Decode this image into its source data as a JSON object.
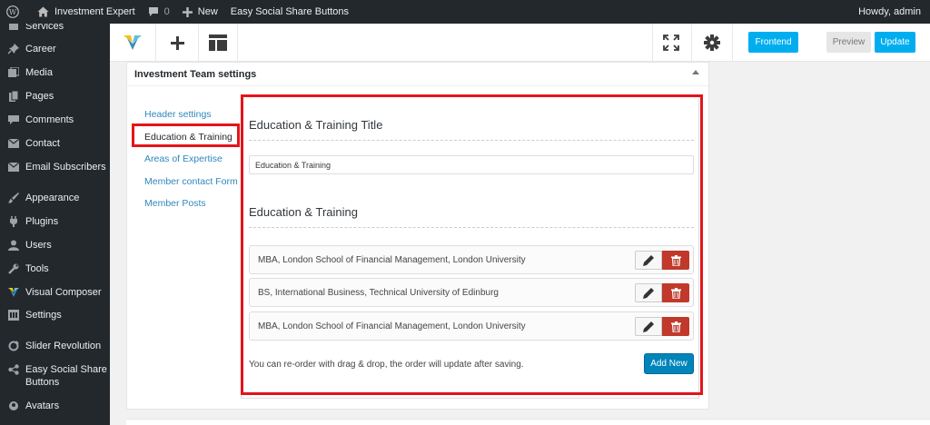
{
  "admin_bar": {
    "site_name": "Investment Expert",
    "comments_count": "0",
    "new_label": "New",
    "plugin_label": "Easy Social Share Buttons",
    "greeting": "Howdy, admin"
  },
  "sidebar": {
    "items": [
      {
        "label": "Services",
        "icon": "services-icon"
      },
      {
        "label": "Career",
        "icon": "pin-icon"
      },
      {
        "label": "Media",
        "icon": "media-icon"
      },
      {
        "label": "Pages",
        "icon": "pages-icon"
      },
      {
        "label": "Comments",
        "icon": "comments-icon"
      },
      {
        "label": "Contact",
        "icon": "envelope-icon"
      },
      {
        "label": "Email Subscribers",
        "icon": "email-icon"
      },
      {
        "label": "Appearance",
        "icon": "brush-icon"
      },
      {
        "label": "Plugins",
        "icon": "plugin-icon"
      },
      {
        "label": "Users",
        "icon": "user-icon"
      },
      {
        "label": "Tools",
        "icon": "wrench-icon"
      },
      {
        "label": "Visual Composer",
        "icon": "visual-composer-icon"
      },
      {
        "label": "Settings",
        "icon": "settings-icon"
      },
      {
        "label": "Slider Revolution",
        "icon": "refresh-icon"
      },
      {
        "label": "Easy Social Share Buttons",
        "icon": "share-icon"
      },
      {
        "label": "Avatars",
        "icon": "avatar-icon"
      }
    ]
  },
  "toolbar": {
    "frontend_label": "Frontend",
    "preview_label": "Preview",
    "update_label": "Update"
  },
  "panel": {
    "title": "Investment Team settings",
    "tabs": [
      {
        "label": "Header settings"
      },
      {
        "label": "Education & Training"
      },
      {
        "label": "Areas of Expertise"
      },
      {
        "label": "Member contact Form"
      },
      {
        "label": "Member Posts"
      }
    ],
    "active_tab": "Education & Training",
    "title_section_heading": "Education & Training Title",
    "title_input_value": "Education & Training",
    "list_section_heading": "Education & Training",
    "rows": [
      {
        "text": "MBA, London School of Financial Management, London University"
      },
      {
        "text": "BS, International Business, Technical University of Edinburg"
      },
      {
        "text": "MBA, London School of Financial Management, London University"
      }
    ],
    "help_text": "You can re-order with drag & drop, the order will update after saving.",
    "add_new_label": "Add New"
  },
  "colors": {
    "admin_dark": "#23282d",
    "accent_blue": "#00aef0",
    "link_blue": "#2f87bd",
    "delete_red": "#c0392b",
    "highlight_red": "#e4141a"
  }
}
